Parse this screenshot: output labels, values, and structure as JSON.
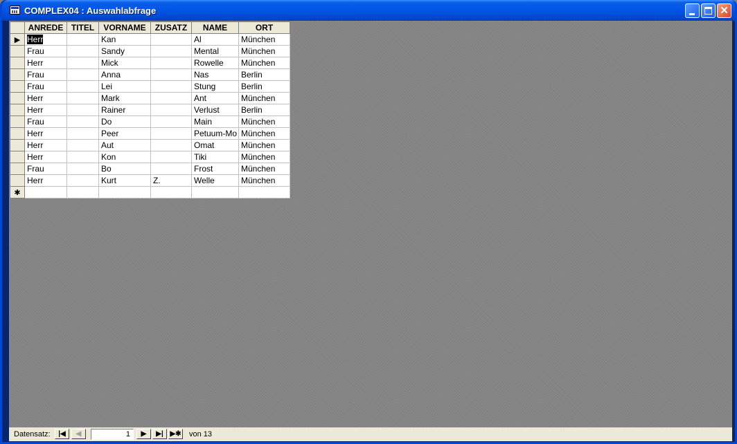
{
  "window": {
    "title": "COMPLEX04 : Auswahlabfrage",
    "close_glyph": "✕"
  },
  "grid": {
    "columns": [
      "ANREDE",
      "TITEL",
      "VORNAME",
      "ZUSATZ",
      "NAME",
      "ORT"
    ],
    "rows": [
      [
        "Herr",
        "",
        "Kan",
        "",
        "Al",
        "München"
      ],
      [
        "Frau",
        "",
        "Sandy",
        "",
        "Mental",
        "München"
      ],
      [
        "Herr",
        "",
        "Mick",
        "",
        "Rowelle",
        "München"
      ],
      [
        "Frau",
        "",
        "Anna",
        "",
        "Nas",
        "Berlin"
      ],
      [
        "Frau",
        "",
        "Lei",
        "",
        "Stung",
        "Berlin"
      ],
      [
        "Herr",
        "",
        "Mark",
        "",
        "Ant",
        "München"
      ],
      [
        "Herr",
        "",
        "Rainer",
        "",
        "Verlust",
        "Berlin"
      ],
      [
        "Frau",
        "",
        "Do",
        "",
        "Main",
        "München"
      ],
      [
        "Herr",
        "",
        "Peer",
        "",
        "Petuum-Mo",
        "München"
      ],
      [
        "Herr",
        "",
        "Aut",
        "",
        "Omat",
        "München"
      ],
      [
        "Herr",
        "",
        "Kon",
        "",
        "Tiki",
        "München"
      ],
      [
        "Frau",
        "",
        "Bo",
        "",
        "Frost",
        "München"
      ],
      [
        "Herr",
        "",
        "Kurt",
        "Z.",
        "Welle",
        "München"
      ]
    ],
    "current_row_marker": "▶",
    "new_row_marker": "✱"
  },
  "statusbar": {
    "label": "Datensatz:",
    "current_record": "1",
    "of_text": "von 13",
    "nav": {
      "first": "|◀",
      "prev": "◀",
      "next": "▶",
      "last": "▶|",
      "new": "▶✱"
    }
  }
}
